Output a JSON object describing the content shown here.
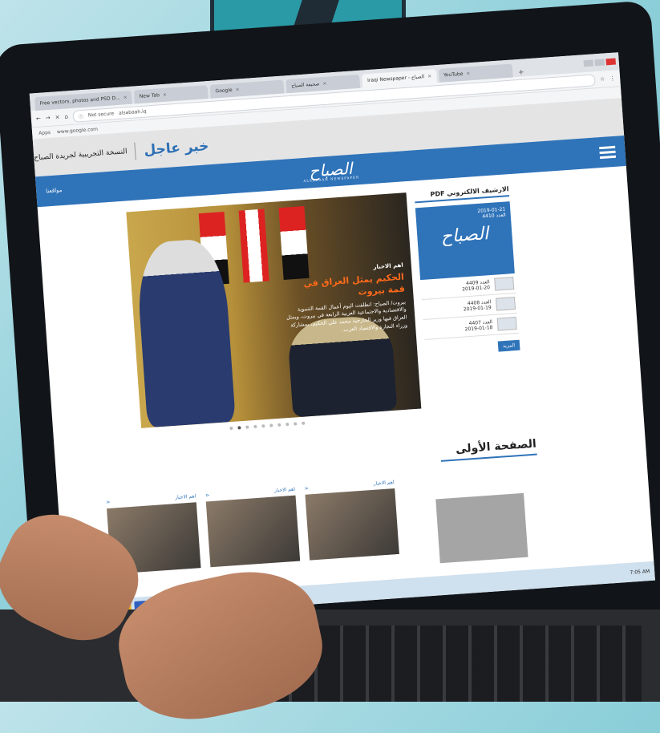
{
  "browser": {
    "tabs": [
      {
        "label": "Free vectors, photos and PSD D...",
        "active": false
      },
      {
        "label": "New Tab",
        "active": false
      },
      {
        "label": "Google",
        "active": false
      },
      {
        "label": "صحيفة الصباح",
        "active": false
      },
      {
        "label": "Iraqi Newspaper - الصباح",
        "active": true
      },
      {
        "label": "YouTube",
        "active": false
      }
    ],
    "security": "Not secure",
    "url": "alsabaah.iq",
    "bookmarks": [
      "Apps",
      "www.google.com"
    ]
  },
  "site": {
    "breaking_label": "خبر عاجل",
    "breaking_text": "النسخة التجريبية لجريدة الصباح",
    "logo": "الصباح",
    "logo_tag": "ALSABAAH NEWSPAPER",
    "nav_date": "مواقعنا",
    "slide": {
      "category": "اهم الاخبار",
      "title": "الحكيم يمثل العراق في قمة بيروت",
      "desc": "بيروت/ الصباح: انطلقت اليوم أعمال القمة التنموية والاقتصادية والاجتماعية العربية الرابعة في بيروت، ويمثل العراق فيها وزير الخارجية محمد علي الحكيم، بمشاركة وزراء التجارة والاقتصاد العرب."
    },
    "pdf_archive": {
      "title": "الارشيف الالكتروني PDF",
      "cover_date": "2019-01-21",
      "cover_issue": "العدد 4410",
      "issues": [
        {
          "label": "العدد 4409",
          "date": "2019-01-20"
        },
        {
          "label": "العدد 4408",
          "date": "2019-01-19"
        },
        {
          "label": "العدد 4407",
          "date": "2019-01-18"
        }
      ],
      "more": "المزيد"
    },
    "first_page_title": "الصفحة الأولى",
    "cards": [
      {
        "category": "اهم الاخبار"
      },
      {
        "category": "اهم الاخبار"
      },
      {
        "category": "اهم الاخبار"
      }
    ],
    "clock": "7:05 AM"
  },
  "colors": {
    "brand_blue": "#2f73b9",
    "breaking_blue": "#2d6fb5",
    "headline_orange": "#ff6a1a"
  }
}
